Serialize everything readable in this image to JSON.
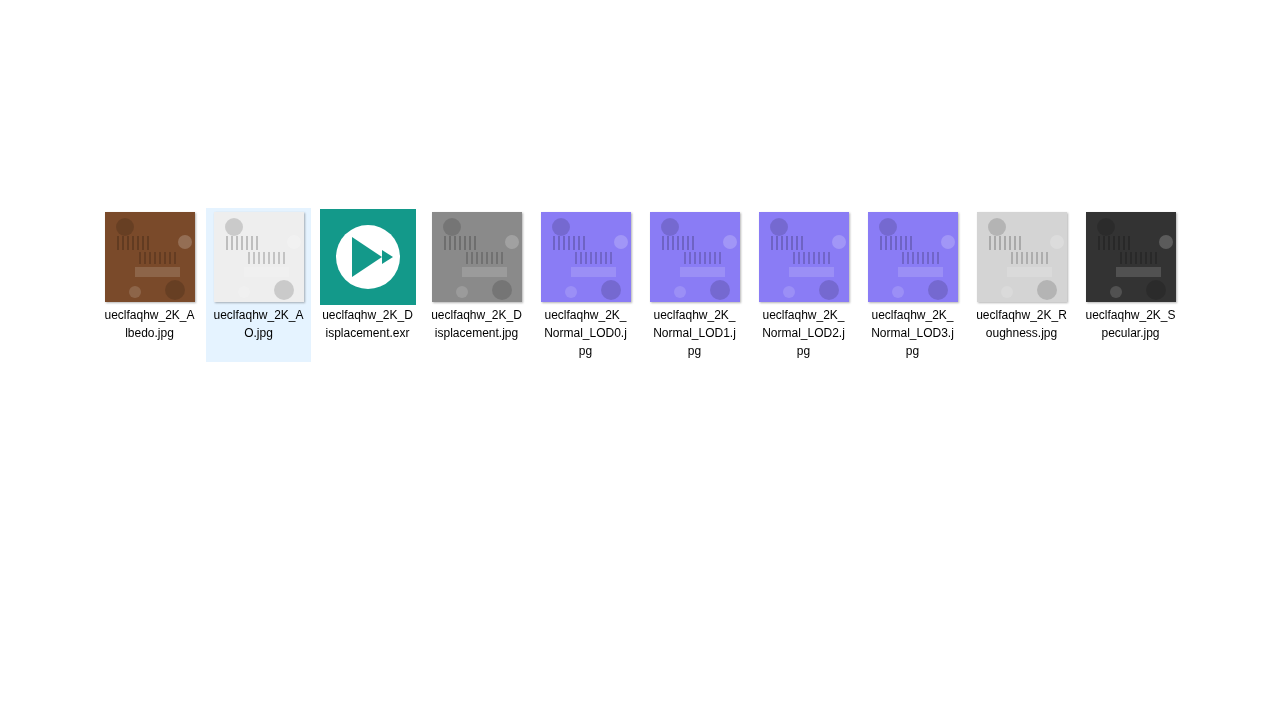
{
  "files": [
    {
      "kind": "picture",
      "color": "#7a4a2a",
      "name_lines": [
        "ueclfaqhw_2K_A",
        "lbedo.jpg"
      ],
      "selected": false
    },
    {
      "kind": "picture",
      "color": "#eeeeee",
      "name_lines": [
        "ueclfaqhw_2K_A",
        "O.jpg"
      ],
      "selected": true
    },
    {
      "kind": "app",
      "color": "#13998a",
      "name_lines": [
        "ueclfaqhw_2K_D",
        "isplacement.exr"
      ],
      "selected": false
    },
    {
      "kind": "picture",
      "color": "#8a8a8a",
      "name_lines": [
        "ueclfaqhw_2K_D",
        "isplacement.jpg"
      ],
      "selected": false
    },
    {
      "kind": "picture",
      "color": "#8a7cf5",
      "name_lines": [
        "ueclfaqhw_2K_",
        "Normal_LOD0.j",
        "pg"
      ],
      "selected": false
    },
    {
      "kind": "picture",
      "color": "#8a7cf5",
      "name_lines": [
        "ueclfaqhw_2K_",
        "Normal_LOD1.j",
        "pg"
      ],
      "selected": false
    },
    {
      "kind": "picture",
      "color": "#8a7cf5",
      "name_lines": [
        "ueclfaqhw_2K_",
        "Normal_LOD2.j",
        "pg"
      ],
      "selected": false
    },
    {
      "kind": "picture",
      "color": "#8a7cf5",
      "name_lines": [
        "ueclfaqhw_2K_",
        "Normal_LOD3.j",
        "pg"
      ],
      "selected": false
    },
    {
      "kind": "picture",
      "color": "#d4d4d4",
      "name_lines": [
        "ueclfaqhw_2K_R",
        "oughness.jpg"
      ],
      "selected": false
    },
    {
      "kind": "picture",
      "color": "#333333",
      "name_lines": [
        "ueclfaqhw_2K_S",
        "pecular.jpg"
      ],
      "selected": false
    }
  ]
}
